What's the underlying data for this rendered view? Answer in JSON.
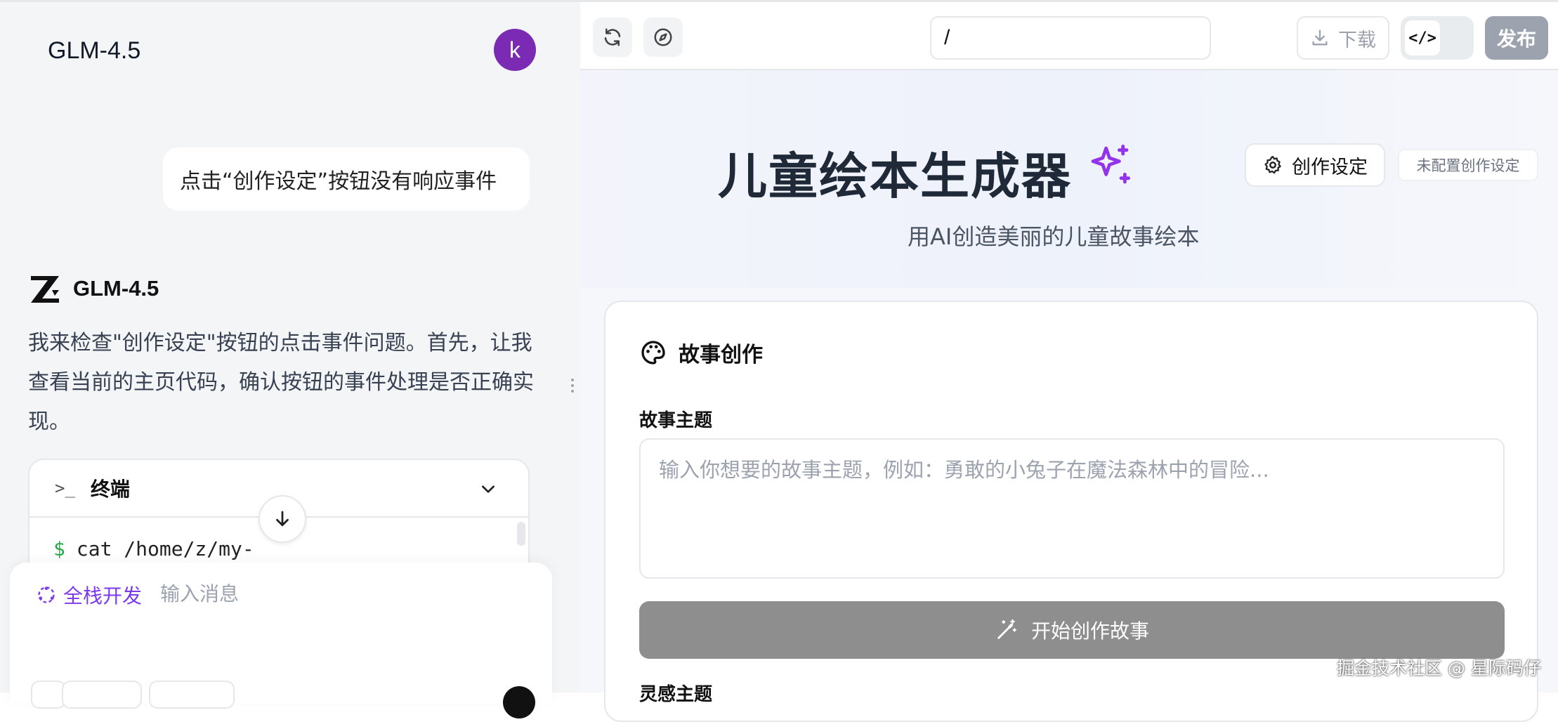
{
  "chat": {
    "title": "GLM-4.5",
    "avatar_initial": "k",
    "user_message": "点击“创作设定”按钮没有响应事件",
    "model_name": "GLM-4.5",
    "assistant_message": "我来检查\"创作设定\"按钮的点击事件问题。首先，让我查看当前的主页代码，确认按钮的事件处理是否正确实现。",
    "terminal": {
      "label": "终端",
      "command": "cat /home/z/my-",
      "prompt": "$"
    },
    "composer": {
      "mode_label": "全栈开发",
      "placeholder": "输入消息"
    }
  },
  "preview_toolbar": {
    "url": "/",
    "download_label": "下载",
    "code_toggle_label": "</>",
    "publish_label": "发布"
  },
  "app": {
    "title": "儿童绘本生成器",
    "subtitle": "用AI创造美丽的儿童故事绘本",
    "settings_button": "创作设定",
    "settings_status": "未配置创作设定",
    "card_title": "故事创作",
    "topic_label": "故事主题",
    "topic_placeholder": "输入你想要的故事主题，例如：勇敢的小兔子在魔法森林中的冒险...",
    "start_button": "开始创作故事",
    "inspiration_label": "灵感主题"
  },
  "watermark": "掘金技术社区 @ 星际码仔",
  "colors": {
    "avatar_bg": "#7b2bb3",
    "accent_purple": "#7c3aed",
    "disabled_button": "#8e8e8e",
    "terminal_prompt": "#22a845"
  },
  "icons": [
    "refresh-icon",
    "compass-icon",
    "download-icon",
    "code-icon",
    "gear-icon",
    "sparkle-icon",
    "palette-icon",
    "magic-wand-icon",
    "terminal-icon",
    "chevron-down-icon",
    "arrow-down-icon"
  ]
}
